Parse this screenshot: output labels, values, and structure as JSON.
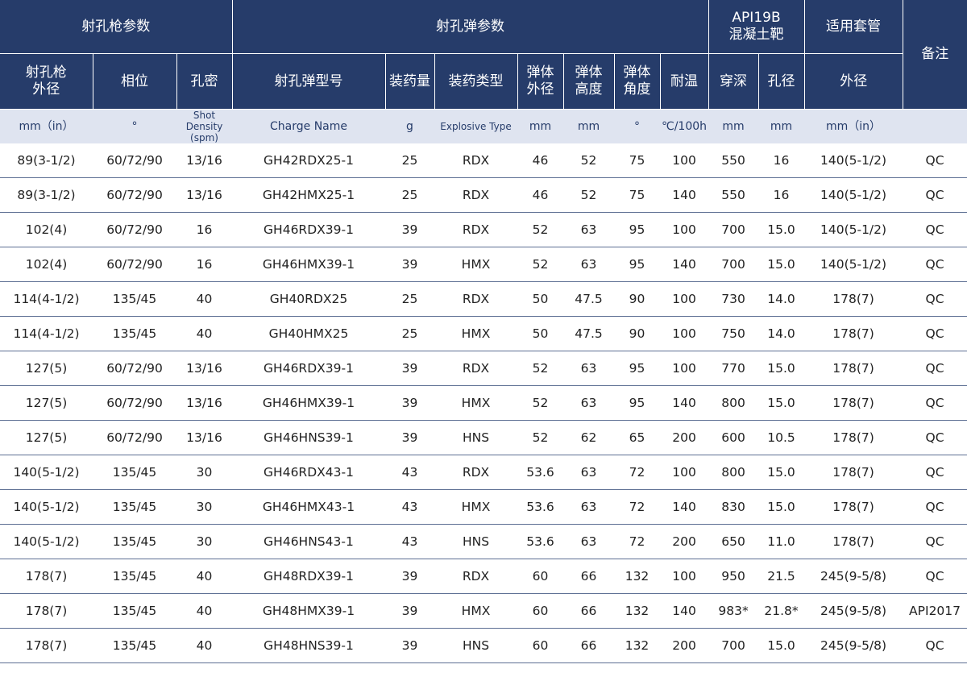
{
  "header": {
    "groups": [
      "射孔枪参数",
      "射孔弹参数",
      "API19B\n混凝土靶",
      "适用套管",
      "备注"
    ],
    "columns": [
      "射孔枪\n外径",
      "相位",
      "孔密",
      "射孔弹型号",
      "装药量",
      "装药类型",
      "弹体\n外径",
      "弹体\n高度",
      "弹体\n角度",
      "耐温",
      "穿深",
      "孔径",
      "外径"
    ]
  },
  "units": [
    "mm（in）",
    "°",
    "Shot Density\n(spm)",
    "Charge Name",
    "g",
    "Explosive Type",
    "mm",
    "mm",
    "°",
    "℃/100h",
    "mm",
    "mm",
    "mm（in）",
    ""
  ],
  "rows": [
    [
      "89(3-1/2)",
      "60/72/90",
      "13/16",
      "GH42RDX25-1",
      "25",
      "RDX",
      "46",
      "52",
      "75",
      "100",
      "550",
      "16",
      "140(5-1/2)",
      "QC"
    ],
    [
      "89(3-1/2)",
      "60/72/90",
      "13/16",
      "GH42HMX25-1",
      "25",
      "RDX",
      "46",
      "52",
      "75",
      "140",
      "550",
      "16",
      "140(5-1/2)",
      "QC"
    ],
    [
      "102(4)",
      "60/72/90",
      "16",
      "GH46RDX39-1",
      "39",
      "RDX",
      "52",
      "63",
      "95",
      "100",
      "700",
      "15.0",
      "140(5-1/2)",
      "QC"
    ],
    [
      "102(4)",
      "60/72/90",
      "16",
      "GH46HMX39-1",
      "39",
      "HMX",
      "52",
      "63",
      "95",
      "140",
      "700",
      "15.0",
      "140(5-1/2)",
      "QC"
    ],
    [
      "114(4-1/2)",
      "135/45",
      "40",
      "GH40RDX25",
      "25",
      "RDX",
      "50",
      "47.5",
      "90",
      "100",
      "730",
      "14.0",
      "178(7)",
      "QC"
    ],
    [
      "114(4-1/2)",
      "135/45",
      "40",
      "GH40HMX25",
      "25",
      "HMX",
      "50",
      "47.5",
      "90",
      "100",
      "750",
      "14.0",
      "178(7)",
      "QC"
    ],
    [
      "127(5)",
      "60/72/90",
      "13/16",
      "GH46RDX39-1",
      "39",
      "RDX",
      "52",
      "63",
      "95",
      "100",
      "770",
      "15.0",
      "178(7)",
      "QC"
    ],
    [
      "127(5)",
      "60/72/90",
      "13/16",
      "GH46HMX39-1",
      "39",
      "HMX",
      "52",
      "63",
      "95",
      "140",
      "800",
      "15.0",
      "178(7)",
      "QC"
    ],
    [
      "127(5)",
      "60/72/90",
      "13/16",
      "GH46HNS39-1",
      "39",
      "HNS",
      "52",
      "62",
      "65",
      "200",
      "600",
      "10.5",
      "178(7)",
      "QC"
    ],
    [
      "140(5-1/2)",
      "135/45",
      "30",
      "GH46RDX43-1",
      "43",
      "RDX",
      "53.6",
      "63",
      "72",
      "100",
      "800",
      "15.0",
      "178(7)",
      "QC"
    ],
    [
      "140(5-1/2)",
      "135/45",
      "30",
      "GH46HMX43-1",
      "43",
      "HMX",
      "53.6",
      "63",
      "72",
      "140",
      "830",
      "15.0",
      "178(7)",
      "QC"
    ],
    [
      "140(5-1/2)",
      "135/45",
      "30",
      "GH46HNS43-1",
      "43",
      "HNS",
      "53.6",
      "63",
      "72",
      "200",
      "650",
      "11.0",
      "178(7)",
      "QC"
    ],
    [
      "178(7)",
      "135/45",
      "40",
      "GH48RDX39-1",
      "39",
      "RDX",
      "60",
      "66",
      "132",
      "100",
      "950",
      "21.5",
      "245(9-5/8)",
      "QC"
    ],
    [
      "178(7)",
      "135/45",
      "40",
      "GH48HMX39-1",
      "39",
      "HMX",
      "60",
      "66",
      "132",
      "140",
      "983*",
      "21.8*",
      "245(9-5/8)",
      "API2017"
    ],
    [
      "178(7)",
      "135/45",
      "40",
      "GH48HNS39-1",
      "39",
      "HNS",
      "60",
      "66",
      "132",
      "200",
      "700",
      "15.0",
      "245(9-5/8)",
      "QC"
    ]
  ],
  "colors": {
    "header_bg": "#263c6a",
    "unit_bg": "#dfe4f0",
    "row_border": "#5d6f93"
  }
}
